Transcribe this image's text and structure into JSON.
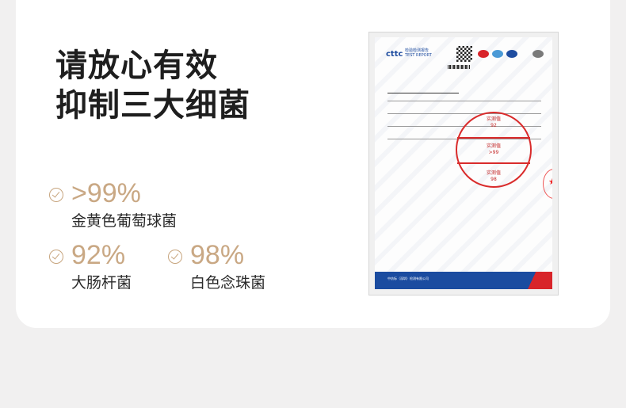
{
  "headline": {
    "line1": "请放心有效",
    "line2": "抑制三大细菌"
  },
  "stats": [
    {
      "value": ">99%",
      "label": "金黄色葡萄球菌"
    },
    {
      "value": "92%",
      "label": "大肠杆菌"
    },
    {
      "value": "98%",
      "label": "白色念珠菌"
    }
  ],
  "report": {
    "logo": "cttc",
    "logo_sub": "检验检测报告",
    "logo_en": "TEST REPORT",
    "stamp_label": "实测值",
    "stamp_values": [
      "92",
      ">99",
      "98"
    ],
    "footer": "中纺标（深圳）检测有限公司"
  },
  "colors": {
    "accent": "#c9a884",
    "card": "#ffffff",
    "background": "#f1f0f0",
    "stamp": "#d92b2b",
    "report_bar": "#1b4ca0"
  }
}
